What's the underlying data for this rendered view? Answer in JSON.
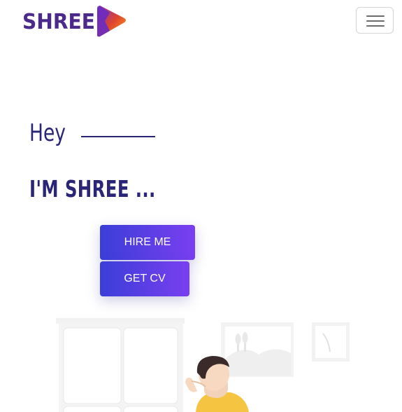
{
  "nav": {
    "logo_text": "SHREE",
    "toggler_icon": "hamburger-menu-icon"
  },
  "hero": {
    "greeting": "Hey",
    "name": "I'M SHREE ...",
    "hire_label": "HIRE ME",
    "cv_label": "GET CV"
  },
  "colors": {
    "brand_purple": "#4b2a8c",
    "heading": "#2b2578",
    "accent_orange": "#f59a1b",
    "button_gradient_start": "#3b3ed9",
    "button_gradient_end": "#7a3ff0"
  },
  "illustration": {
    "icon": "person-at-desk-illustration"
  }
}
